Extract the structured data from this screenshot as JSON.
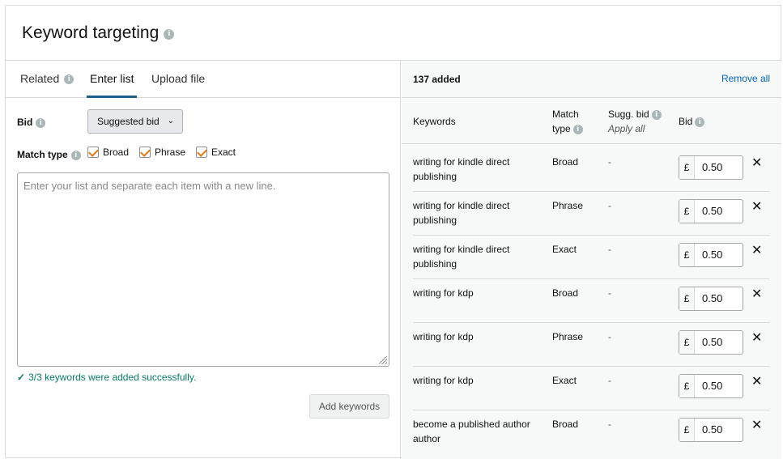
{
  "header": {
    "title": "Keyword targeting",
    "info_icon": "info-icon"
  },
  "tabs": [
    {
      "label": "Related",
      "has_info": true
    },
    {
      "label": "Enter list",
      "active": true
    },
    {
      "label": "Upload file"
    }
  ],
  "form": {
    "bid_label": "Bid",
    "bid_button": "Suggested bid",
    "match_type_label": "Match type",
    "match_types": [
      {
        "label": "Broad",
        "checked": true
      },
      {
        "label": "Phrase",
        "checked": true
      },
      {
        "label": "Exact",
        "checked": true
      }
    ],
    "textarea_placeholder": "Enter your list and separate each item with a new line.",
    "success_message": "3/3 keywords were added successfully.",
    "add_button": "Add keywords"
  },
  "added": {
    "count_label": "137 added",
    "remove_all": "Remove all",
    "columns": {
      "keywords": "Keywords",
      "match_type_1": "Match",
      "match_type_2": "type",
      "sugg_bid": "Sugg. bid",
      "apply_all": "Apply all",
      "bid": "Bid"
    },
    "rows": [
      {
        "keyword": "writing for kindle direct publishing",
        "match": "Broad",
        "sugg": "-",
        "currency": "£",
        "bid": "0.50"
      },
      {
        "keyword": "writing for kindle direct publishing",
        "match": "Phrase",
        "sugg": "-",
        "currency": "£",
        "bid": "0.50"
      },
      {
        "keyword": "writing for kindle direct publishing",
        "match": "Exact",
        "sugg": "-",
        "currency": "£",
        "bid": "0.50"
      },
      {
        "keyword": "writing for kdp",
        "match": "Broad",
        "sugg": "-",
        "currency": "£",
        "bid": "0.50"
      },
      {
        "keyword": "writing for kdp",
        "match": "Phrase",
        "sugg": "-",
        "currency": "£",
        "bid": "0.50"
      },
      {
        "keyword": "writing for kdp",
        "match": "Exact",
        "sugg": "-",
        "currency": "£",
        "bid": "0.50"
      },
      {
        "keyword": "become a published author author",
        "match": "Broad",
        "sugg": "-",
        "currency": "£",
        "bid": "0.50"
      }
    ]
  },
  "colors": {
    "accent_orange": "#e47911",
    "link_blue": "#0066c0",
    "success_green": "#067d62",
    "tab_underline": "#1f5f8b"
  }
}
